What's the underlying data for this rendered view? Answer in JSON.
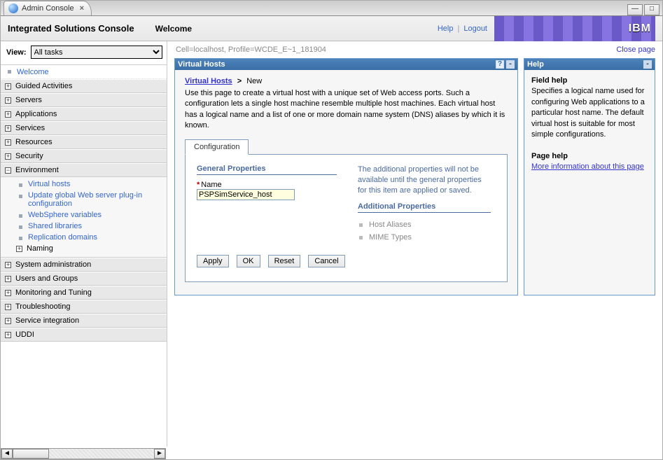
{
  "browserTab": {
    "title": "Admin Console"
  },
  "header": {
    "title": "Integrated Solutions Console",
    "welcome": "Welcome",
    "help": "Help",
    "logout": "Logout",
    "brand": "IBM"
  },
  "view": {
    "label": "View:",
    "selected": "All tasks",
    "options": [
      "All tasks"
    ]
  },
  "nav": {
    "welcome": "Welcome",
    "items": [
      {
        "label": "Guided Activities",
        "state": "closed"
      },
      {
        "label": "Servers",
        "state": "closed"
      },
      {
        "label": "Applications",
        "state": "closed"
      },
      {
        "label": "Services",
        "state": "closed"
      },
      {
        "label": "Resources",
        "state": "closed"
      },
      {
        "label": "Security",
        "state": "closed"
      },
      {
        "label": "Environment",
        "state": "open",
        "children": [
          {
            "label": "Virtual hosts",
            "type": "link"
          },
          {
            "label": "Update global Web server plug-in configuration",
            "type": "link"
          },
          {
            "label": "WebSphere variables",
            "type": "link"
          },
          {
            "label": "Shared libraries",
            "type": "link"
          },
          {
            "label": "Replication domains",
            "type": "link"
          },
          {
            "label": "Naming",
            "type": "expand"
          }
        ]
      },
      {
        "label": "System administration",
        "state": "closed"
      },
      {
        "label": "Users and Groups",
        "state": "closed"
      },
      {
        "label": "Monitoring and Tuning",
        "state": "closed"
      },
      {
        "label": "Troubleshooting",
        "state": "closed"
      },
      {
        "label": "Service integration",
        "state": "closed"
      },
      {
        "label": "UDDI",
        "state": "closed"
      }
    ]
  },
  "context": {
    "line": "Cell=localhost, Profile=WCDE_E~1_181904",
    "close": "Close page"
  },
  "mainPanel": {
    "title": "Virtual Hosts",
    "breadcrumb": {
      "link": "Virtual Hosts",
      "sep": ">",
      "current": "New"
    },
    "description": "Use this page to create a virtual host with a unique set of Web access ports. Such a configuration lets a single host machine resemble multiple host machines. Each virtual host has a logical name and a list of one or more domain name system (DNS) aliases by which it is known.",
    "tab": "Configuration",
    "generalProps": "General Properties",
    "nameLabel": "Name",
    "nameValue": "PSPSimService_host",
    "unavailable": "The additional properties will not be available until the general properties for this item are applied or saved.",
    "additionalProps": "Additional Properties",
    "apItems": [
      "Host Aliases",
      "MIME Types"
    ],
    "buttons": {
      "apply": "Apply",
      "ok": "OK",
      "reset": "Reset",
      "cancel": "Cancel"
    }
  },
  "helpPanel": {
    "title": "Help",
    "fieldHelp": "Field help",
    "fieldHelpText": "Specifies a logical name used for configuring Web applications to a particular host name. The default virtual host is suitable for most simple configurations.",
    "pageHelp": "Page help",
    "moreInfo": "More information about this page"
  }
}
